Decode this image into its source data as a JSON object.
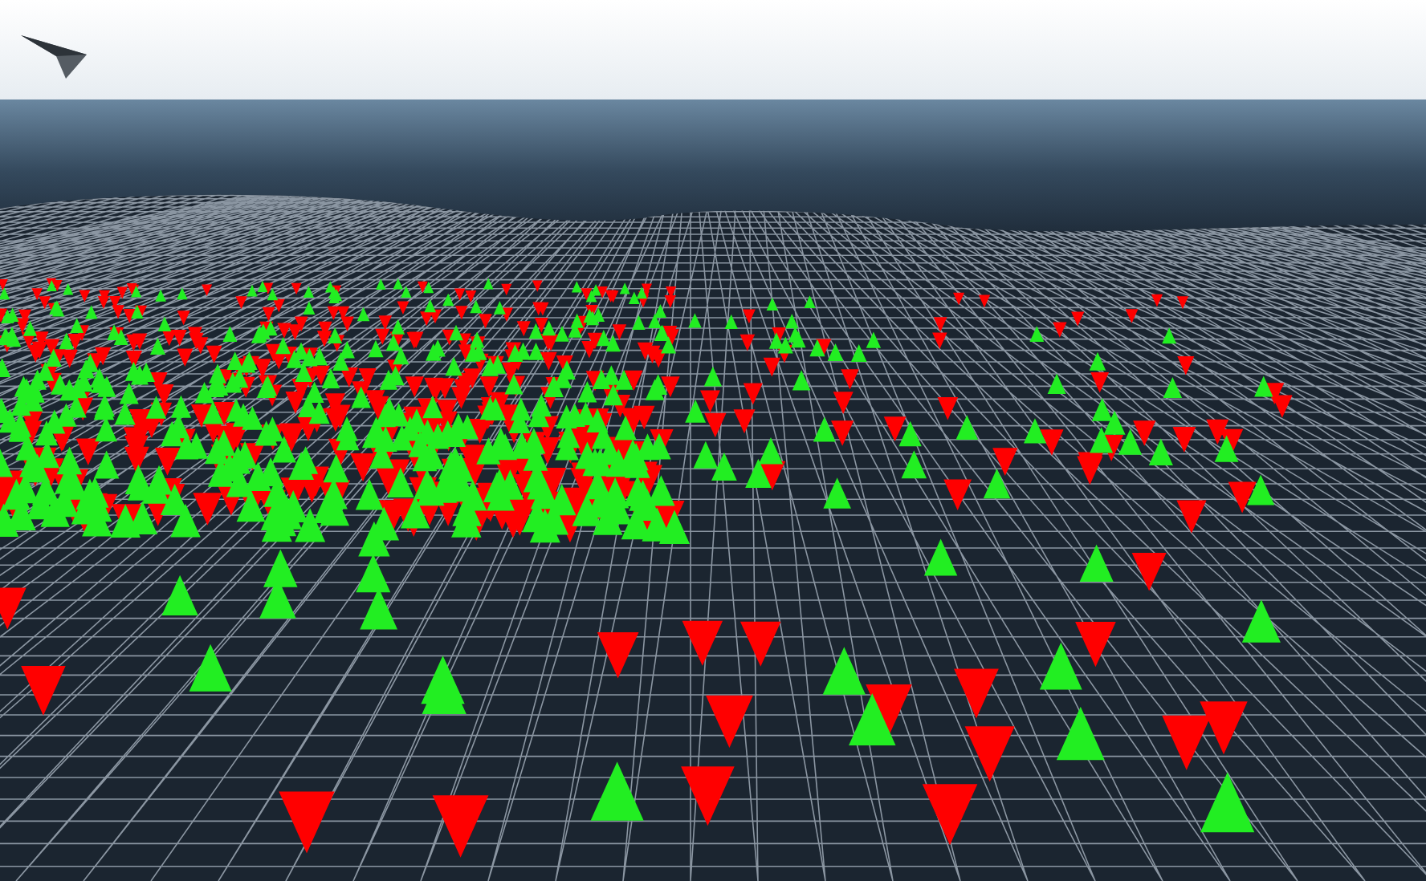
{
  "scene": {
    "kind": "wireframe-terrain"
  },
  "markers": [
    {
      "kind": "down-cone",
      "color": "#ff0000"
    },
    {
      "kind": "up-cone",
      "color": "#22ee22"
    }
  ],
  "pointer": {
    "kind": "paper-plane"
  }
}
